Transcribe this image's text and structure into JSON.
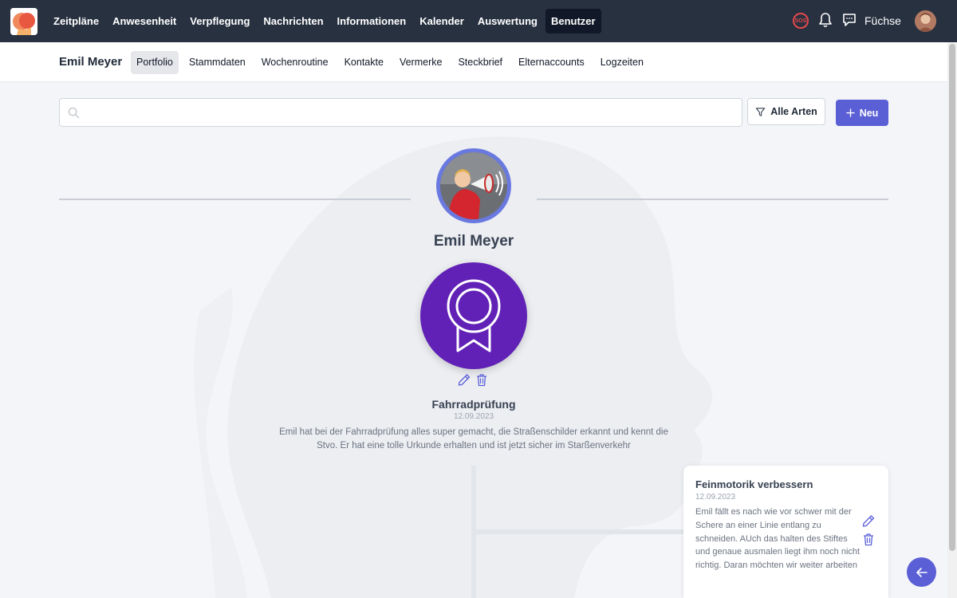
{
  "nav": {
    "items": [
      {
        "label": "Zeitpläne"
      },
      {
        "label": "Anwesenheit"
      },
      {
        "label": "Verpflegung"
      },
      {
        "label": "Nachrichten"
      },
      {
        "label": "Informationen"
      },
      {
        "label": "Kalender"
      },
      {
        "label": "Auswertung"
      },
      {
        "label": "Benutzer",
        "active": true
      }
    ],
    "sos_label": "SOS",
    "group_name": "Füchse",
    "bg_color": "#283140"
  },
  "subnav": {
    "child_name": "Emil Meyer",
    "tabs": [
      {
        "label": "Portfolio",
        "active": true
      },
      {
        "label": "Stammdaten"
      },
      {
        "label": "Wochenroutine"
      },
      {
        "label": "Kontakte"
      },
      {
        "label": "Vermerke"
      },
      {
        "label": "Steckbrief"
      },
      {
        "label": "Elternaccounts"
      },
      {
        "label": "Logzeiten"
      }
    ]
  },
  "toolbar": {
    "search_value": "",
    "search_placeholder": "",
    "filter_label": "Alle Arten",
    "new_label": "Neu",
    "accent_color": "#5b5fd6"
  },
  "profile": {
    "name": "Emil Meyer"
  },
  "entries": [
    {
      "title": "Fahrradprüfung",
      "date": "12.09.2023",
      "text": "Emil hat bei der Fahrradprüfung alles super gemacht, die Straßenschilder erkannt und kennt die Stvo. Er hat eine tolle Urkunde erhalten und ist jetzt sicher im Starßenverkehr",
      "icon": "award-icon",
      "icon_bg": "#6121b6"
    },
    {
      "title": "Feinmotorik verbessern",
      "date": "12.09.2023",
      "text": "Emil fällt es nach wie vor schwer mit der Schere an einer Linie entlang zu schneiden. AUch das halten des Stiftes und genaue ausmalen liegt ihm noch nicht richtig. Daran möchten wir weiter arbeiten"
    }
  ]
}
